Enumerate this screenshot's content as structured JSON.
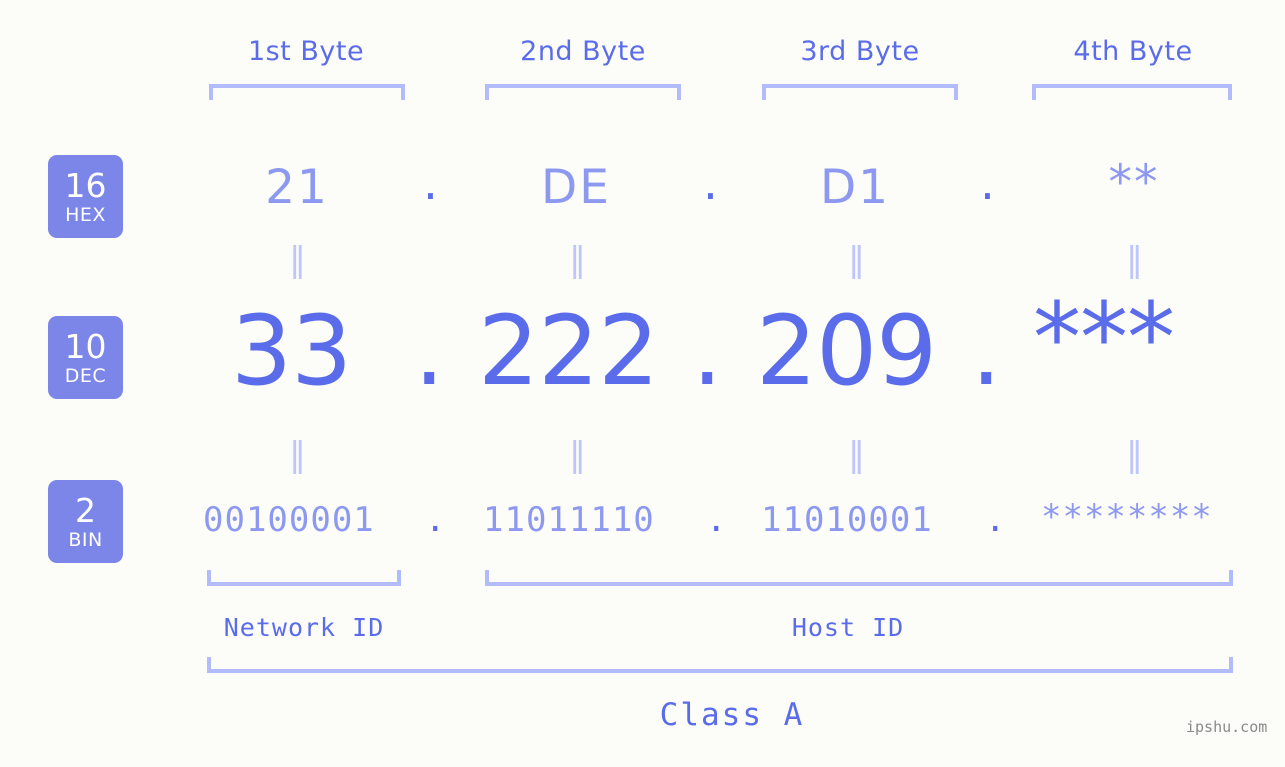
{
  "meta": {
    "watermark": "ipshu.com",
    "background": "#fcfdf8",
    "accent": "#5b6ceb",
    "accent_light": "#8d99f0",
    "accent_pale": "#b3bcfb",
    "badge_bg": "#7b86e8"
  },
  "byte_headers": [
    {
      "label": "1st Byte"
    },
    {
      "label": "2nd Byte"
    },
    {
      "label": "3rd Byte"
    },
    {
      "label": "4th Byte"
    }
  ],
  "bases": [
    {
      "num": "16",
      "name": "HEX"
    },
    {
      "num": "10",
      "name": "DEC"
    },
    {
      "num": "2",
      "name": "BIN"
    }
  ],
  "rows": {
    "hex": {
      "values": [
        "21",
        "DE",
        "D1",
        "**"
      ],
      "separator": "."
    },
    "dec": {
      "values": [
        "33",
        "222",
        "209",
        "***"
      ],
      "separator": "."
    },
    "bin": {
      "values": [
        "00100001",
        "11011110",
        "11010001",
        "********"
      ],
      "separator": "."
    }
  },
  "equals_marks": [
    "‖",
    "‖",
    "‖",
    "‖",
    "‖",
    "‖",
    "‖",
    "‖"
  ],
  "footer": {
    "network_id": "Network ID",
    "host_id": "Host ID",
    "class": "Class A"
  }
}
